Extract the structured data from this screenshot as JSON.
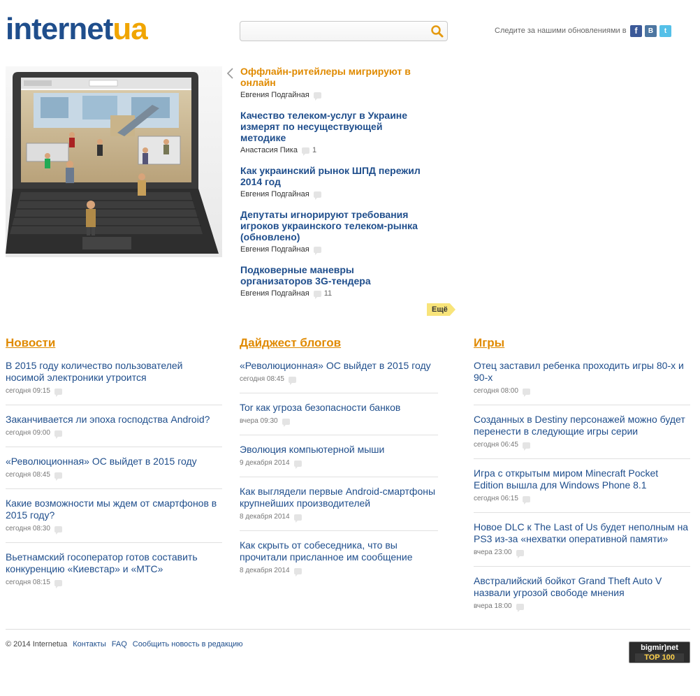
{
  "header": {
    "logo_part1": "internet",
    "logo_part2": "ua",
    "search_placeholder": "",
    "follow_text": "Следите за нашими обновлениями в",
    "social": [
      "facebook-icon",
      "vkontakte-icon",
      "twitter-icon"
    ]
  },
  "featured": {
    "items": [
      {
        "title": "Оффлайн-ритейлеры мигрируют в онлайн",
        "author": "Евгения Подгайная",
        "comments": ""
      },
      {
        "title": "Качество телеком-услуг в Украине измерят по несуществующей методике",
        "author": "Анастасия Пика",
        "comments": "1"
      },
      {
        "title": "Как украинский рынок ШПД пережил 2014 год",
        "author": "Евгения Подгайная",
        "comments": ""
      },
      {
        "title": "Депутаты игнорируют требования игроков украинского телеком-рынка (обновлено)",
        "author": "Евгения Подгайная",
        "comments": ""
      },
      {
        "title": "Подковерные маневры организаторов 3G-тендера",
        "author": "Евгения Подгайная",
        "comments": "11"
      }
    ],
    "more_label": "Ещё"
  },
  "news": {
    "heading": "Новости",
    "items": [
      {
        "title": "В 2015 году количество пользователей носимой электроники утроится",
        "date": "сегодня 09:15"
      },
      {
        "title": "Заканчивается ли эпоха господства Android?",
        "date": "сегодня 09:00"
      },
      {
        "title": "«Революционная» ОС выйдет в 2015 году",
        "date": "сегодня 08:45"
      },
      {
        "title": "Какие возможности мы ждем от смартфонов в 2015 году?",
        "date": "сегодня 08:30"
      },
      {
        "title": "Вьетнамский госоператор готов составить конкуренцию «Киевстар» и «МТС»",
        "date": "сегодня 08:15"
      }
    ]
  },
  "blogs": {
    "heading": "Дайджест блогов",
    "items": [
      {
        "title": "«Революционная» ОС выйдет в 2015 году",
        "date": "сегодня 08:45"
      },
      {
        "title": "Tor как угроза безопасности банков",
        "date": "вчера 09:30"
      },
      {
        "title": "Эволюция компьютерной мыши",
        "date": "9 декабря 2014"
      },
      {
        "title": "Как выглядели первые Android-смартфоны крупнейших производителей",
        "date": "8 декабря 2014"
      },
      {
        "title": "Как скрыть от собеседника, что вы прочитали присланное им сообщение",
        "date": "8 декабря 2014"
      }
    ]
  },
  "games": {
    "heading": "Игры",
    "items": [
      {
        "title": "Отец заставил ребенка проходить игры 80-х и 90-х",
        "date": "сегодня 08:00"
      },
      {
        "title": "Созданных в Destiny персонажей можно будет перенести в следующие игры серии",
        "date": "сегодня 06:45"
      },
      {
        "title": "Игра с открытым миром Minecraft Pocket Edition вышла для Windows Phone 8.1",
        "date": "сегодня 06:15"
      },
      {
        "title": "Новое DLC к The Last of Us будет неполным на PS3 из-за «нехватки оперативной памяти»",
        "date": "вчера 23:00"
      },
      {
        "title": "Австралийский бойкот Grand Theft Auto V назвали угрозой свободе мнения",
        "date": "вчера 18:00"
      }
    ]
  },
  "footer": {
    "copyright": "© 2014 Internetua",
    "links": [
      "Контакты",
      "FAQ",
      "Сообщить новость в редакцию"
    ],
    "counter_top": "bigmir)net",
    "counter_bottom": "TOP 100"
  },
  "colors": {
    "link": "#1f4e8c",
    "accent": "#e08a00",
    "more_button": "#f8e47a"
  }
}
